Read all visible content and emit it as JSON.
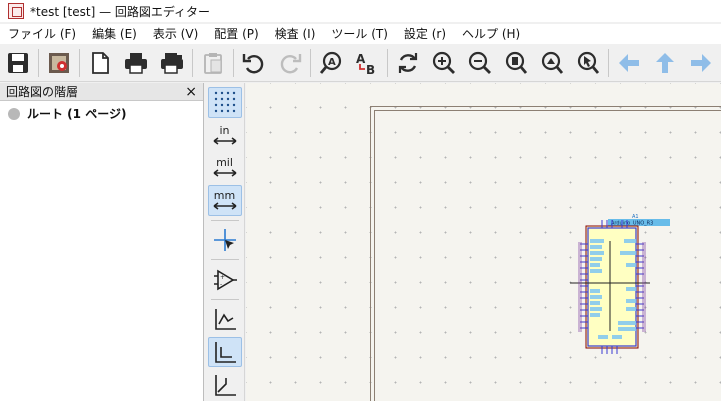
{
  "window": {
    "title": "*test [test] — 回路図エディター"
  },
  "menu": [
    "ファイル (F)",
    "編集 (E)",
    "表示 (V)",
    "配置 (P)",
    "検査 (I)",
    "ツール (T)",
    "設定 (r)",
    "ヘルプ (H)"
  ],
  "toolbar_icons": [
    "save-icon",
    "schematic-setup-icon",
    "page-settings-icon",
    "print-icon",
    "plot-icon",
    "paste-icon",
    "undo-icon",
    "redo-icon",
    "find-icon",
    "find-replace-icon",
    "refresh-icon",
    "zoom-in-icon",
    "zoom-out-icon",
    "zoom-fit-icon",
    "zoom-objects-icon",
    "zoom-selection-icon",
    "nav-back-icon",
    "nav-up-icon",
    "nav-forward-icon"
  ],
  "hierarchy": {
    "title": "回路図の階層",
    "close": "×",
    "root_label": "ルート (1 ページ)"
  },
  "left_toolbar": {
    "unit_in": "in",
    "unit_mil": "mil",
    "unit_mm": "mm"
  },
  "component": {
    "reference": "A1",
    "value": "Arduino_UNO_R3"
  },
  "colors": {
    "accent_blue": "#2b7bd1",
    "disabled_blue": "#8fbde8",
    "symbol_body": "#ffffc2",
    "symbol_border": "#840000",
    "pin_color": "#3a3ad0"
  }
}
